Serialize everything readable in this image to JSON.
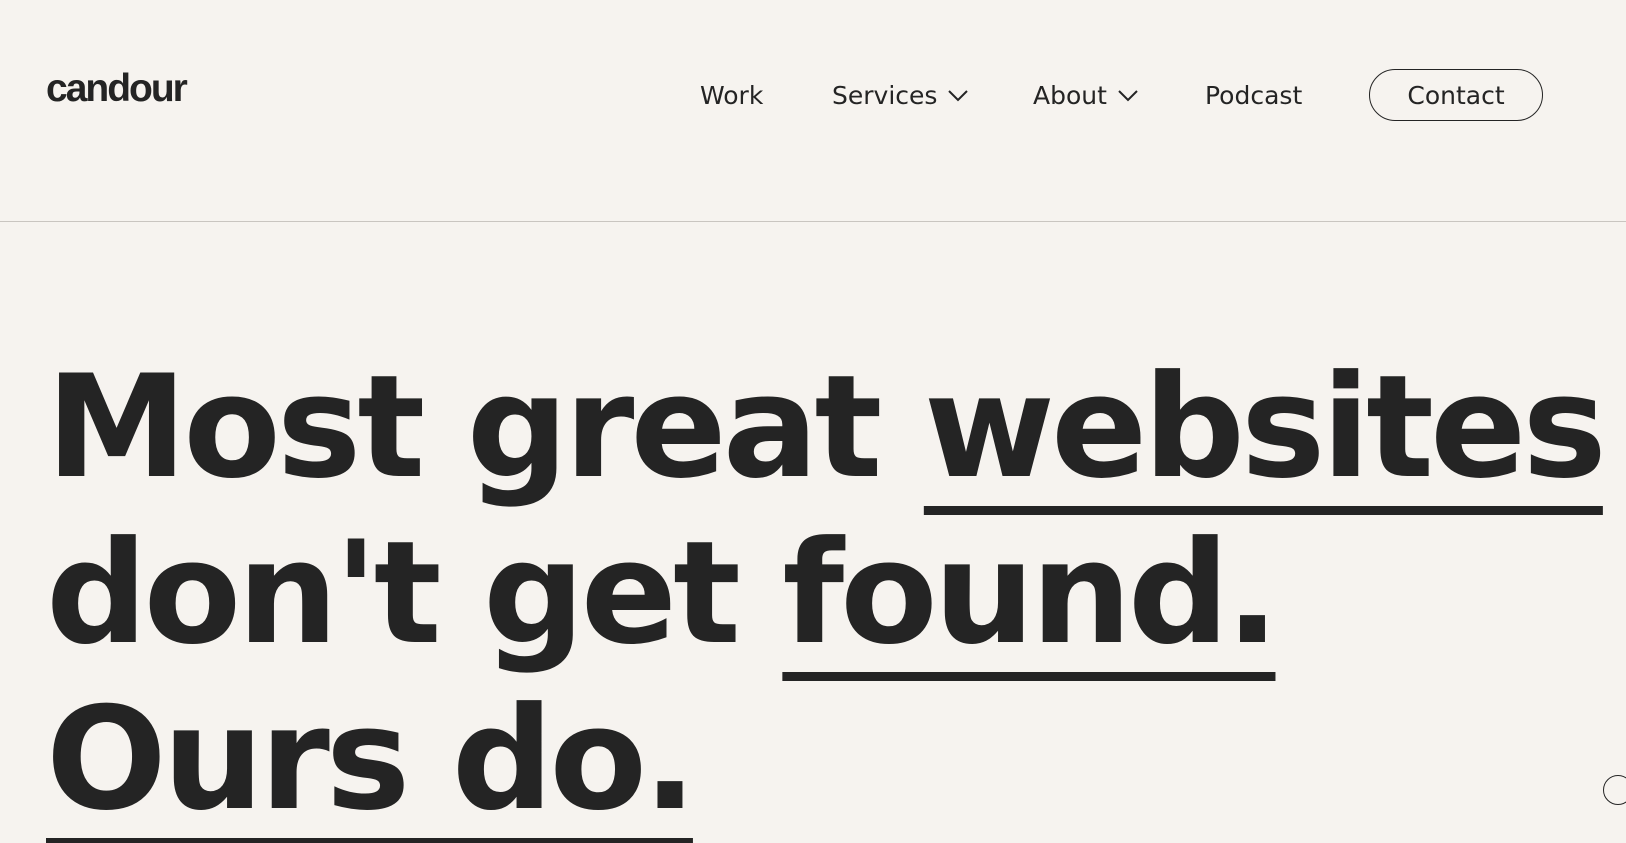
{
  "brand": {
    "logo_text": "candour"
  },
  "nav": {
    "items": [
      {
        "label": "Work"
      },
      {
        "label": "Services",
        "icon": "chevron-down-icon"
      },
      {
        "label": "About",
        "icon": "chevron-down-icon"
      },
      {
        "label": "Podcast"
      }
    ],
    "contact_label": "Contact"
  },
  "hero": {
    "line1_plain": "Most great ",
    "line1_underlined": "websites",
    "line2_plain": "don't get ",
    "line2_underlined": "found.",
    "line3_underlined": "Ours do."
  },
  "colors": {
    "background": "#f6f3ef",
    "text": "#242424",
    "divider": "#c9c5c0"
  },
  "corner_icon": "circle-button-icon"
}
